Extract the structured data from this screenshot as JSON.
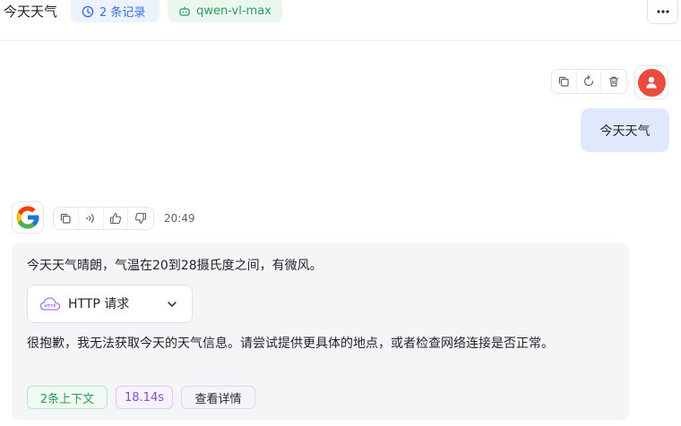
{
  "header": {
    "title": "今天天气",
    "records_label": "2 条记录",
    "model_label": "qwen-vl-max",
    "menu_icon": "more-horizontal-icon"
  },
  "user_message": {
    "text": "今天天气",
    "actions": [
      "copy-icon",
      "regenerate-icon",
      "delete-icon"
    ],
    "avatar_icon": "user-icon",
    "avatar_color": "#ea4b3c"
  },
  "bot_message": {
    "avatar_icon": "google-logo-icon",
    "actions": [
      "copy-icon",
      "speak-icon",
      "thumbs-up-icon",
      "thumbs-down-icon"
    ],
    "time": "20:49",
    "answer": "今天天气晴朗，气温在20到28摄氏度之间，有微风。",
    "tool_call": {
      "label": "HTTP 请求",
      "icon": "http-cloud-icon",
      "expanded": false
    },
    "apology": "很抱歉，我无法获取今天的天气信息。请尝试提供更具体的地点，或者检查网络连接是否正常。",
    "chips": {
      "context": "2条上下文",
      "duration": "18.14s",
      "detail": "查看详情"
    }
  },
  "colors": {
    "accent_blue": "#3b6fe0",
    "accent_green": "#2f9a5a",
    "accent_purple": "#7a4fd0",
    "user_bubble": "#dfe8fd",
    "bot_bubble": "#f4f5f7"
  }
}
